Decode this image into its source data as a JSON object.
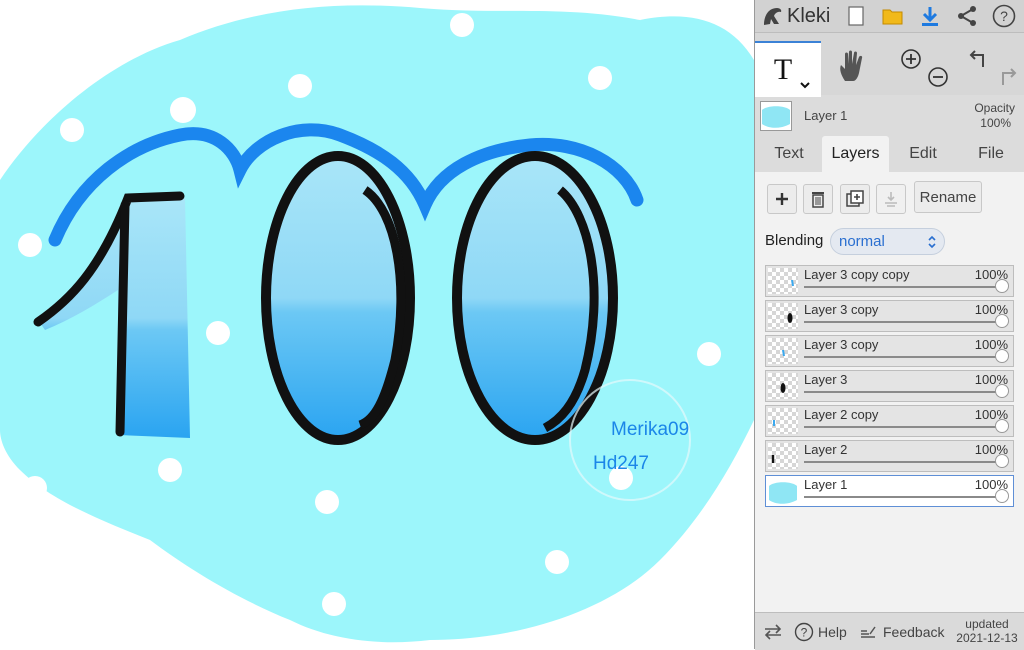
{
  "app": {
    "name": "Kleki"
  },
  "canvas": {
    "signature_1": "Merika09",
    "signature_2": "Hd247"
  },
  "toolbar": {
    "icons": [
      "new-image-icon",
      "open-folder-icon",
      "download-icon",
      "share-icon",
      "help-icon"
    ],
    "tools": [
      "text-tool-icon",
      "hand-tool-icon",
      "zoom-in-icon",
      "zoom-out-icon",
      "undo-icon",
      "redo-icon"
    ]
  },
  "current_layer": {
    "name": "Layer 1",
    "opacity_label": "Opacity",
    "opacity_value": "100%"
  },
  "tabs": [
    {
      "label": "Text",
      "active": false
    },
    {
      "label": "Layers",
      "active": true
    },
    {
      "label": "Edit",
      "active": false
    },
    {
      "label": "File",
      "active": false
    }
  ],
  "layer_actions": {
    "rename_label": "Rename"
  },
  "blending": {
    "label": "Blending",
    "value": "normal"
  },
  "layers": [
    {
      "name": "Layer 3 copy copy",
      "opacity": "100%",
      "opacity_value": 1.0,
      "selected": false
    },
    {
      "name": "Layer 3 copy",
      "opacity": "100%",
      "opacity_value": 1.0,
      "selected": false
    },
    {
      "name": "Layer 3 copy",
      "opacity": "100%",
      "opacity_value": 1.0,
      "selected": false
    },
    {
      "name": "Layer 3",
      "opacity": "100%",
      "opacity_value": 1.0,
      "selected": false
    },
    {
      "name": "Layer 2 copy",
      "opacity": "100%",
      "opacity_value": 1.0,
      "selected": false
    },
    {
      "name": "Layer 2",
      "opacity": "100%",
      "opacity_value": 1.0,
      "selected": false
    },
    {
      "name": "Layer 1",
      "opacity": "100%",
      "opacity_value": 1.0,
      "selected": true
    }
  ],
  "bottom": {
    "help_label": "Help",
    "feedback_label": "Feedback",
    "updated_label": "updated",
    "updated_date": "2021-12-13"
  },
  "colors": {
    "accent": "#1e7ae0",
    "cloud": "#9cf6fb",
    "outline_blue": "#1b86ee",
    "digit_light": "#a6e3f7",
    "digit_dark": "#2aa8f2"
  }
}
